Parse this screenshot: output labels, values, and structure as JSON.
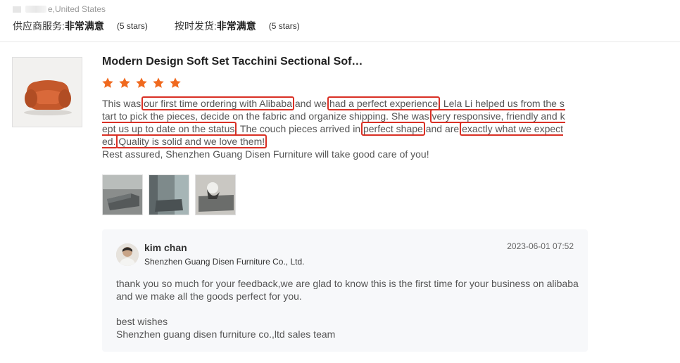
{
  "header": {
    "location": "e,United States",
    "ratings": [
      {
        "label": "供应商服务:",
        "value": "非常满意",
        "stars": "(5 stars)"
      },
      {
        "label": "按时发货:",
        "value": "非常满意",
        "stars": "(5 stars)"
      }
    ]
  },
  "review": {
    "product_title": "Modern Design Soft Set Tacchini Sectional Sof…",
    "star_count": 5,
    "star_color": "#f0691e",
    "highlight_color": "#d93025",
    "segments": [
      {
        "t": "This was ",
        "h": false
      },
      {
        "t": "our first time ordering with Alibaba",
        "h": true
      },
      {
        "t": " and we ",
        "h": false
      },
      {
        "t": "had a perfect experience",
        "h": true
      },
      {
        "t": ". Lela Li helped us from the start to pick the pieces, decide on the fabric and organize shipping. She was ",
        "h": false
      },
      {
        "t": "very responsive, friendly and kept us up to date on the status",
        "h": true
      },
      {
        "t": ". The couch pieces arrived in ",
        "h": false
      },
      {
        "t": "perfect shape",
        "h": true
      },
      {
        "t": " and are ",
        "h": false
      },
      {
        "t": "exactly what we expected.",
        "h": true
      },
      {
        "t": " ",
        "h": false
      },
      {
        "t": "Quality is solid and we love them!",
        "h": true
      }
    ],
    "closing": "Rest assured, Shenzhen Guang Disen Furniture will take good care of you!",
    "photos": [
      "sofa-photo-1",
      "sofa-photo-2",
      "sofa-photo-3"
    ]
  },
  "reply": {
    "name": "kim chan",
    "company": "Shenzhen Guang Disen Furniture Co., Ltd.",
    "date": "2023-06-01 07:52",
    "paragraph1": "thank you so much for your feedback,we are glad to know this is the first time for your business on alibaba and we make all the goods perfect for you.",
    "signoff": "best wishes",
    "signature": "Shenzhen guang disen furniture co.,ltd sales team"
  }
}
